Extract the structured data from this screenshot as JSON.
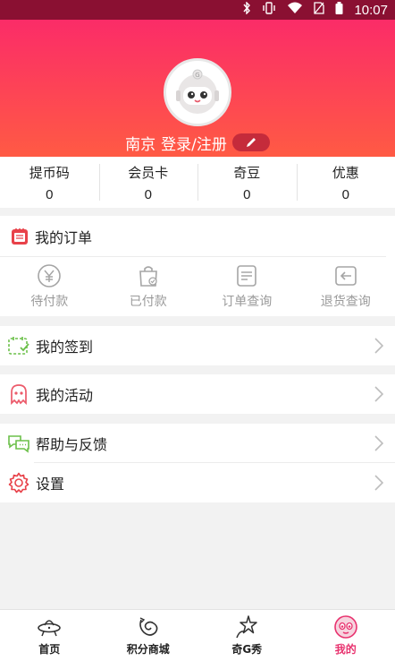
{
  "status_bar": {
    "time": "10:07"
  },
  "profile": {
    "city": "南京",
    "login_label": "登录/注册"
  },
  "stats": [
    {
      "label": "提币码",
      "value": "0"
    },
    {
      "label": "会员卡",
      "value": "0"
    },
    {
      "label": "奇豆",
      "value": "0"
    },
    {
      "label": "优惠",
      "value": "0"
    }
  ],
  "orders": {
    "title": "我的订单",
    "items": [
      {
        "label": "待付款",
        "icon": "yen-coin-icon"
      },
      {
        "label": "已付款",
        "icon": "paid-bag-icon"
      },
      {
        "label": "订单查询",
        "icon": "order-list-icon"
      },
      {
        "label": "退货查询",
        "icon": "return-icon"
      }
    ]
  },
  "menu": {
    "sign_in": "我的签到",
    "activities": "我的活动",
    "help": "帮助与反馈",
    "settings": "设置"
  },
  "tabs": [
    {
      "label": "首页",
      "icon": "ufo-icon"
    },
    {
      "label": "积分商城",
      "icon": "points-mall-icon"
    },
    {
      "label": "奇G秀",
      "icon": "show-star-icon"
    },
    {
      "label": "我的",
      "icon": "profile-face-icon"
    }
  ],
  "colors": {
    "accent": "#e8336f",
    "header_top": "#fb2c68",
    "header_bottom": "#ff5a44"
  }
}
